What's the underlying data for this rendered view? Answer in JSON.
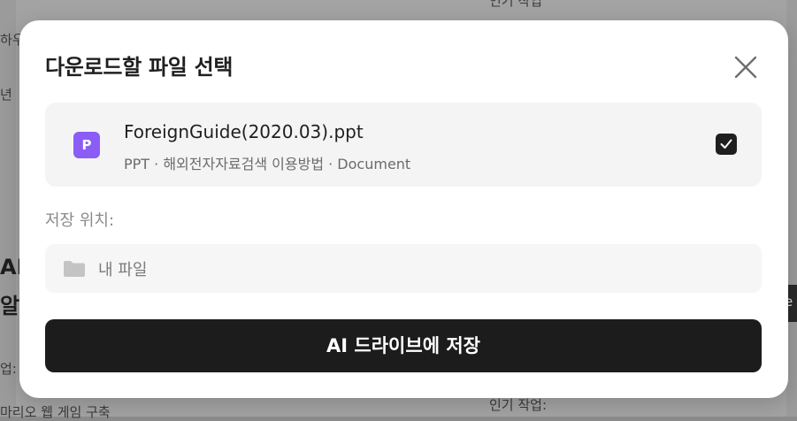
{
  "dialog": {
    "title": "다운로드할 파일 선택",
    "file": {
      "badge": "P",
      "name": "ForeignGuide(2020.03).ppt",
      "meta": "PPT · 해외전자자료검색 이용방법 · Document",
      "checked": true
    },
    "save_location_label": "저장 위치:",
    "location": "내 파일",
    "save_button": "AI 드라이브에 저장"
  },
  "background": {
    "frag1": "하우",
    "frag2": "년",
    "frag3": "AI",
    "frag4": "알기",
    "frag5": "업:",
    "frag6": "마리오 웹 게임 구축",
    "frag7": "인기 작업:",
    "frag8": "인기 작업",
    "frag9": "e"
  },
  "colors": {
    "accent_ppt": "#8b5cf6",
    "button": "#1c1c1c"
  }
}
